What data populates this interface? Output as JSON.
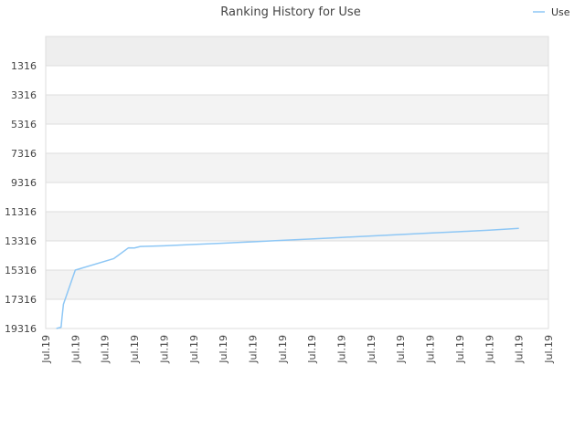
{
  "chart_data": {
    "type": "line",
    "title": "Ranking History for Use",
    "xlabel": "",
    "ylabel": "",
    "legend": {
      "position": "top-right",
      "entries": [
        "Use"
      ]
    },
    "ylim": [
      19316,
      -684
    ],
    "y_inverted": true,
    "grid": true,
    "y_ticks": [
      1316,
      3316,
      5316,
      7316,
      9316,
      11316,
      13316,
      15316,
      17316,
      19316
    ],
    "x_ticks": [
      "Jul.19",
      "Jul.19",
      "Jul.19",
      "Jul.19",
      "Jul.19",
      "Jul.19",
      "Jul.19",
      "Jul.19",
      "Jul.19",
      "Jul.19",
      "Jul.19",
      "Jul.19",
      "Jul.19",
      "Jul.19",
      "Jul.19",
      "Jul.19",
      "Jul.19",
      "Jul.19"
    ],
    "series": [
      {
        "name": "Use",
        "color": "#8ec7f5",
        "points": [
          [
            0.36,
            19316
          ],
          [
            0.52,
            19230
          ],
          [
            0.55,
            18600
          ],
          [
            0.6,
            17650
          ],
          [
            1.0,
            15316
          ],
          [
            2.3,
            14530
          ],
          [
            2.8,
            13790
          ],
          [
            3.0,
            13800
          ],
          [
            3.2,
            13700
          ],
          [
            4.0,
            13650
          ],
          [
            5.0,
            13560
          ],
          [
            6.0,
            13470
          ],
          [
            7.0,
            13380
          ],
          [
            8.0,
            13280
          ],
          [
            9.0,
            13180
          ],
          [
            10.0,
            13080
          ],
          [
            11.0,
            12980
          ],
          [
            12.0,
            12880
          ],
          [
            13.0,
            12780
          ],
          [
            14.0,
            12680
          ],
          [
            15.0,
            12580
          ],
          [
            16.0,
            12460
          ]
        ]
      }
    ]
  }
}
